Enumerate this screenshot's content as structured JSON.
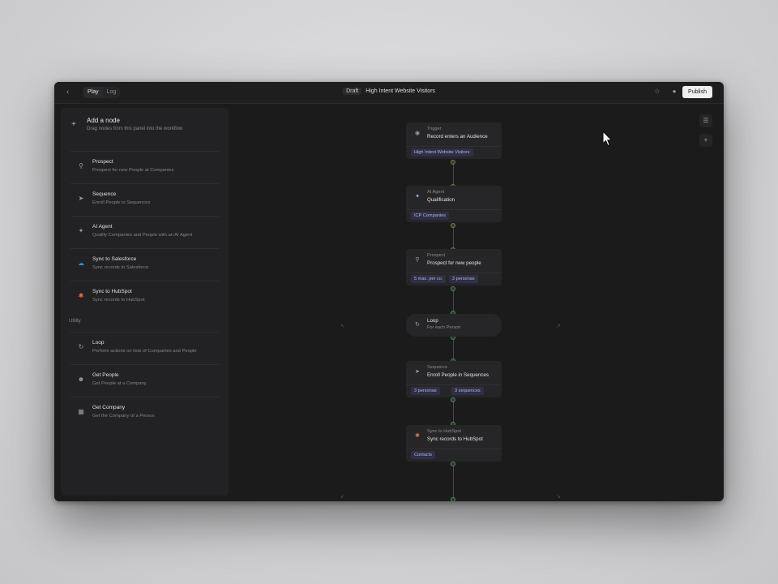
{
  "titlebar": {
    "back_icon": "chevron-left-icon",
    "tabs": [
      {
        "label": "Play",
        "active": true
      },
      {
        "label": "Log",
        "active": false
      }
    ],
    "status_badge": "Draft",
    "title": "High Intent Website Visitors",
    "publish_label": "Publish"
  },
  "panel": {
    "add_node_title": "Add a node",
    "add_node_subtitle": "Drag nodes from this panel into the workflow",
    "items": [
      {
        "title": "Prospect",
        "desc": "Prospect for new People at Companies",
        "icon": "search-icon"
      },
      {
        "title": "Sequence",
        "desc": "Enroll People in Sequences",
        "icon": "send-icon"
      },
      {
        "title": "AI Agent",
        "desc": "Qualify Companies and People with an AI Agent",
        "icon": "sparkle-icon"
      },
      {
        "title": "Sync to Salesforce",
        "desc": "Sync records to Salesforce",
        "icon": "salesforce-icon"
      },
      {
        "title": "Sync to HubSpot",
        "desc": "Sync records to HubSpot",
        "icon": "hubspot-icon"
      }
    ],
    "utility_label": "Utility",
    "utility_items": [
      {
        "title": "Loop",
        "desc": "Perform actions on lists of Companies and People",
        "icon": "loop-icon"
      },
      {
        "title": "Get People",
        "desc": "Get People at a Company",
        "icon": "people-icon"
      },
      {
        "title": "Get Company",
        "desc": "Get the Company of a Person",
        "icon": "building-icon"
      }
    ]
  },
  "workflow": {
    "nodes": [
      {
        "kind": "Trigger",
        "name": "Record enters an Audience",
        "chips": [
          "High Intent Website Visitors"
        ]
      },
      {
        "kind": "AI Agent",
        "name": "Qualification",
        "chips": [
          "ICP Companies"
        ]
      },
      {
        "kind": "Prospect",
        "name": "Prospect for new people",
        "chips": [
          "5 max. per co.",
          "3 personas"
        ]
      },
      {
        "kind": "Loop",
        "name": "For each Person",
        "chips": []
      },
      {
        "kind": "Sequence",
        "name": "Enroll People in Sequences",
        "chips": [
          "3 personas",
          "3 sequences"
        ]
      },
      {
        "kind": "Sync to HubSpot",
        "name": "Sync records to HubSpot",
        "chips": [
          "Contacts"
        ]
      }
    ]
  },
  "colors": {
    "window_bg": "#1b1b1c",
    "panel_bg": "#222224",
    "node_bg": "#262628",
    "chip_bg": "#2f2f45",
    "chip_text": "#b4b4e2",
    "publish_bg": "#efefef"
  }
}
